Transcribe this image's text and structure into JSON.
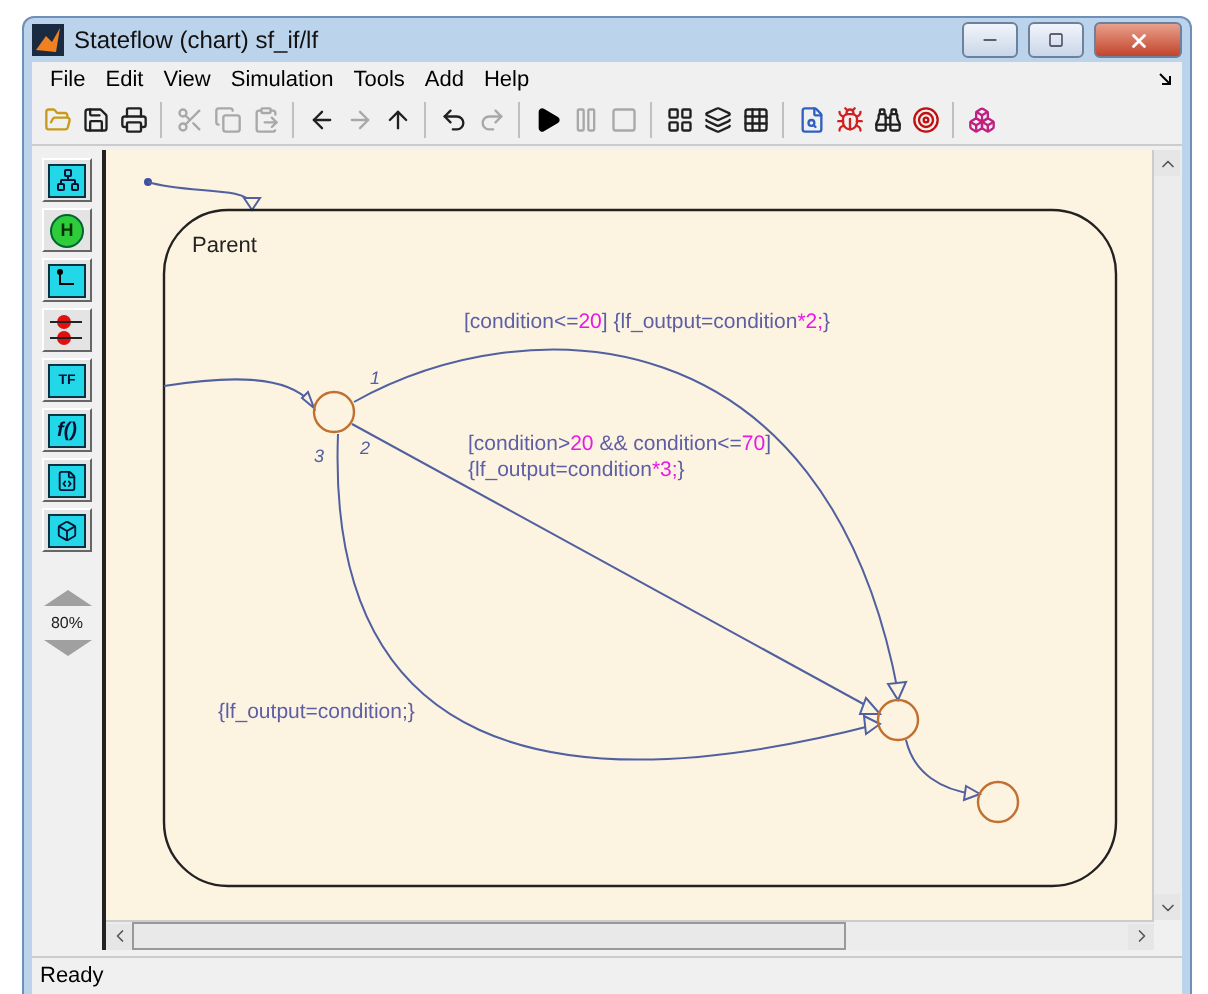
{
  "window": {
    "title": "Stateflow (chart) sf_if/lf"
  },
  "menu": [
    "File",
    "Edit",
    "View",
    "Simulation",
    "Tools",
    "Add",
    "Help"
  ],
  "toolbar": [
    [
      {
        "kind": "open",
        "disabled": false
      },
      {
        "kind": "save",
        "disabled": false
      },
      {
        "kind": "print",
        "disabled": false
      }
    ],
    [
      {
        "kind": "cut",
        "disabled": true
      },
      {
        "kind": "copy",
        "disabled": true
      },
      {
        "kind": "paste",
        "disabled": true
      }
    ],
    [
      {
        "kind": "back",
        "disabled": false
      },
      {
        "kind": "forward",
        "disabled": true
      },
      {
        "kind": "up",
        "disabled": false
      }
    ],
    [
      {
        "kind": "undo",
        "disabled": false
      },
      {
        "kind": "redo",
        "disabled": true
      }
    ],
    [
      {
        "kind": "play",
        "disabled": false
      },
      {
        "kind": "pause",
        "disabled": true
      },
      {
        "kind": "stop",
        "disabled": true
      }
    ],
    [
      {
        "kind": "build",
        "disabled": false
      },
      {
        "kind": "layers",
        "disabled": false
      },
      {
        "kind": "grid",
        "disabled": false
      }
    ],
    [
      {
        "kind": "explore",
        "disabled": false
      },
      {
        "kind": "debug",
        "disabled": false
      },
      {
        "kind": "find",
        "disabled": false
      },
      {
        "kind": "target",
        "disabled": false
      }
    ],
    [
      {
        "kind": "model",
        "disabled": false
      }
    ]
  ],
  "palette": {
    "tools": [
      {
        "kind": "state"
      },
      {
        "kind": "history",
        "label": "H"
      },
      {
        "kind": "default"
      },
      {
        "kind": "junction"
      },
      {
        "kind": "truth",
        "label": "TF"
      },
      {
        "kind": "function",
        "label": "f()"
      },
      {
        "kind": "embedded"
      },
      {
        "kind": "box"
      }
    ],
    "zoom": "80%"
  },
  "chart": {
    "state": {
      "name": "Parent"
    },
    "transitions": [
      {
        "order": "1",
        "label": [
          [
            {
              "kind": "code",
              "text": "[condition<="
            },
            {
              "kind": "number",
              "text": "20"
            },
            {
              "kind": "code",
              "text": "] {lf_output=condition"
            },
            {
              "kind": "number",
              "text": "*2;"
            },
            {
              "kind": "code",
              "text": "}"
            }
          ]
        ]
      },
      {
        "order": "2",
        "label": [
          [
            {
              "kind": "code",
              "text": "[condition>"
            },
            {
              "kind": "number",
              "text": "20"
            },
            {
              "kind": "code",
              "text": " && condition<="
            },
            {
              "kind": "number",
              "text": "70"
            },
            {
              "kind": "code",
              "text": "]"
            }
          ],
          [
            {
              "kind": "code",
              "text": "{lf_output=condition"
            },
            {
              "kind": "number",
              "text": "*3;"
            },
            {
              "kind": "code",
              "text": "}"
            }
          ]
        ]
      },
      {
        "order": "3",
        "label": [
          [
            {
              "kind": "code",
              "text": "{lf_output=condition;}"
            }
          ]
        ]
      }
    ]
  },
  "status_bar": "Ready"
}
